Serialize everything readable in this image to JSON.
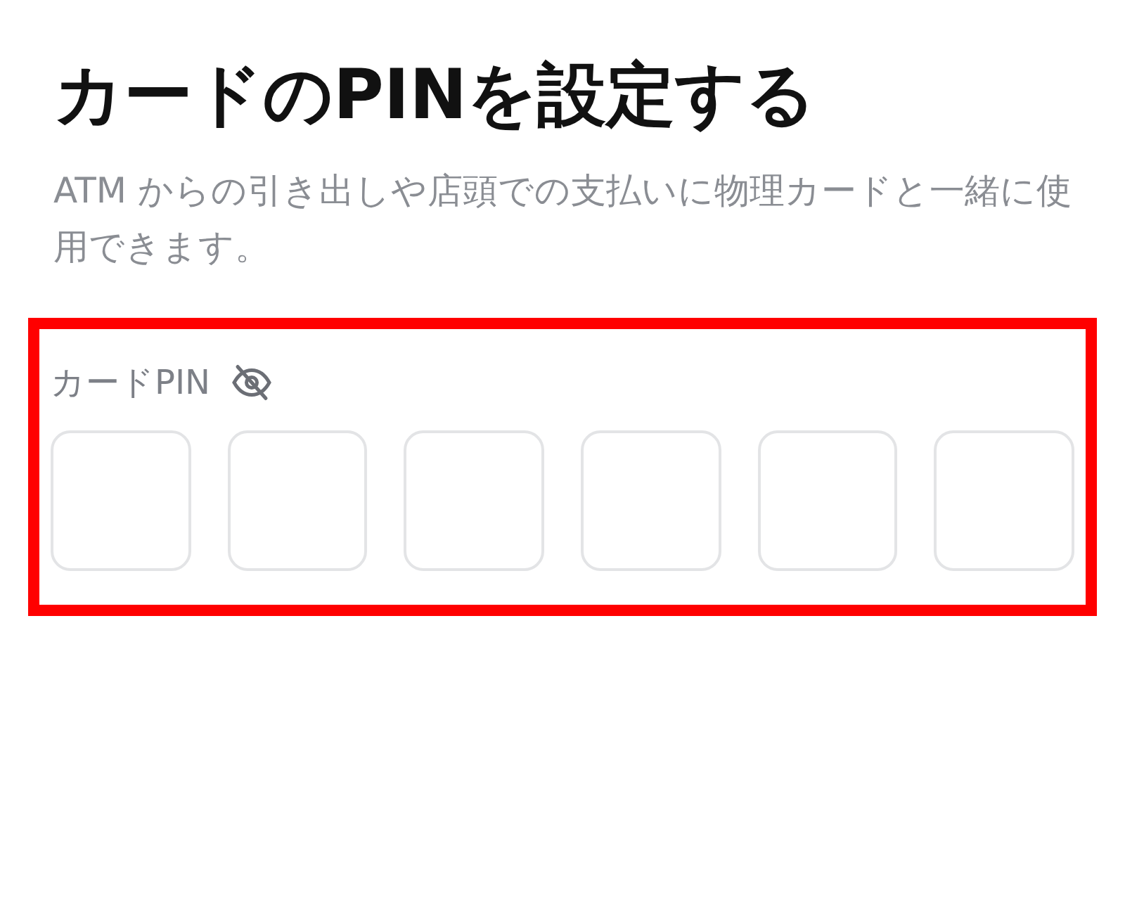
{
  "title": "カードのPINを設定する",
  "description": "ATM からの引き出しや店頭での支払いに物理カードと一緒に使用できます。",
  "pin": {
    "label": "カードPIN",
    "highlighted": true,
    "hidden": true,
    "digit_fields": [
      {
        "kind": "empty"
      },
      {
        "kind": "empty"
      },
      {
        "kind": "empty"
      },
      {
        "kind": "empty"
      },
      {
        "kind": "empty"
      },
      {
        "kind": "empty"
      }
    ]
  }
}
